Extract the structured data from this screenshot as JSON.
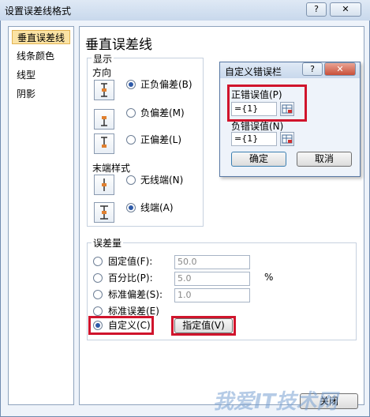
{
  "dialog": {
    "title": "设置误差线格式",
    "help_glyph": "?",
    "close_glyph": "✕"
  },
  "nav": {
    "items": [
      "垂直误差线",
      "线条颜色",
      "线型",
      "阴影"
    ],
    "selected": 0
  },
  "main": {
    "heading": "垂直误差线",
    "display": {
      "legend": "显示",
      "direction_label": "方向",
      "directions": [
        "正负偏差(B)",
        "负偏差(M)",
        "正偏差(L)"
      ],
      "direction_selected": 0,
      "endstyle_label": "末端样式",
      "endstyles": [
        "无线端(N)",
        "线端(A)"
      ],
      "endstyle_selected": 1
    },
    "amount": {
      "legend": "误差量",
      "options": [
        "固定值(F):",
        "百分比(P):",
        "标准偏差(S):",
        "标准误差(E)",
        "自定义(C)"
      ],
      "selected": 4,
      "fixed_value": "50.0",
      "percent_value": "5.0",
      "percent_unit": "%",
      "stddev_value": "1.0",
      "specify_button": "指定值(V)"
    },
    "close_button": "关闭"
  },
  "popup": {
    "title": "自定义错误栏",
    "help_glyph": "?",
    "close_glyph": "✕",
    "positive_label": "正错误值(P)",
    "positive_value": "={1}",
    "negative_label": "负错误值(N)",
    "negative_value": "={1}",
    "ok_button": "确定",
    "cancel_button": "取消"
  },
  "watermark": {
    "text": "我爱IT技术网"
  },
  "colors": {
    "highlight": "#d0142c",
    "selection": "#fbe3a4",
    "radio_dot": "#2e5aa8"
  }
}
